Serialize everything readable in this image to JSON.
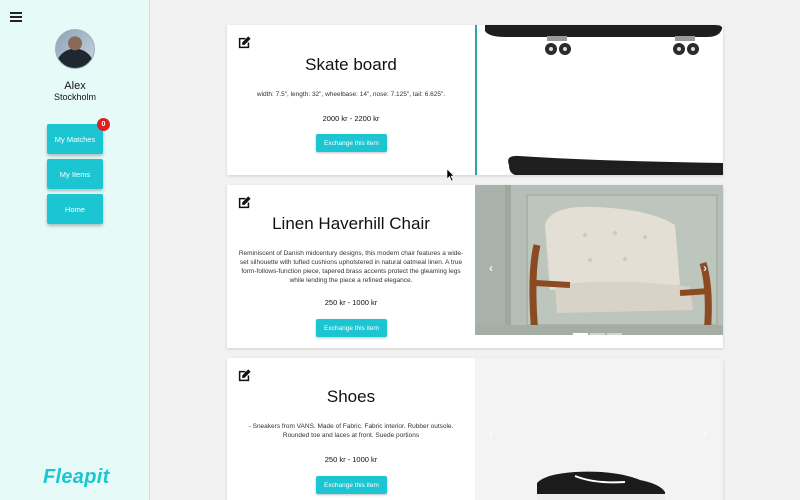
{
  "sidebar": {
    "user_name": "Alex",
    "user_city": "Stockholm",
    "buttons": [
      {
        "label": "My Matches",
        "badge": "0"
      },
      {
        "label": "My Items"
      },
      {
        "label": "Home"
      }
    ],
    "brand": "Fleapit"
  },
  "items": [
    {
      "title": "Skate board",
      "description": "width: 7.5\", length: 32\", wheelbase: 14\", nose: 7.125\", tail: 6.625\".",
      "price": "2000 kr - 2200 kr",
      "button": "Exchange this item",
      "image": "skateboard-image"
    },
    {
      "title": "Linen Haverhill Chair",
      "description": "Reminiscent of Danish midcentury designs, this modern chair features a wide- set silhouette with tufted cushions upholstered in natural oatmeal linen. A true form-follows-function piece, tapered brass accents protect the gleaming legs while lending the piece a refined elegance.",
      "price": "250 kr - 1000 kr",
      "button": "Exchange this item",
      "image": "armchair-image"
    },
    {
      "title": "Shoes",
      "description": "- Sneakers from VANS. Made of Fabric. Fabric interior. Rubber outsole. Rounded toe and laces at front. Suede portions",
      "price": "250 kr - 1000 kr",
      "button": "Exchange this item",
      "image": "sneaker-image"
    }
  ],
  "colors": {
    "accent": "#1cc5d2",
    "sidebar_bg": "#e6fbf8",
    "badge": "#e02020"
  }
}
